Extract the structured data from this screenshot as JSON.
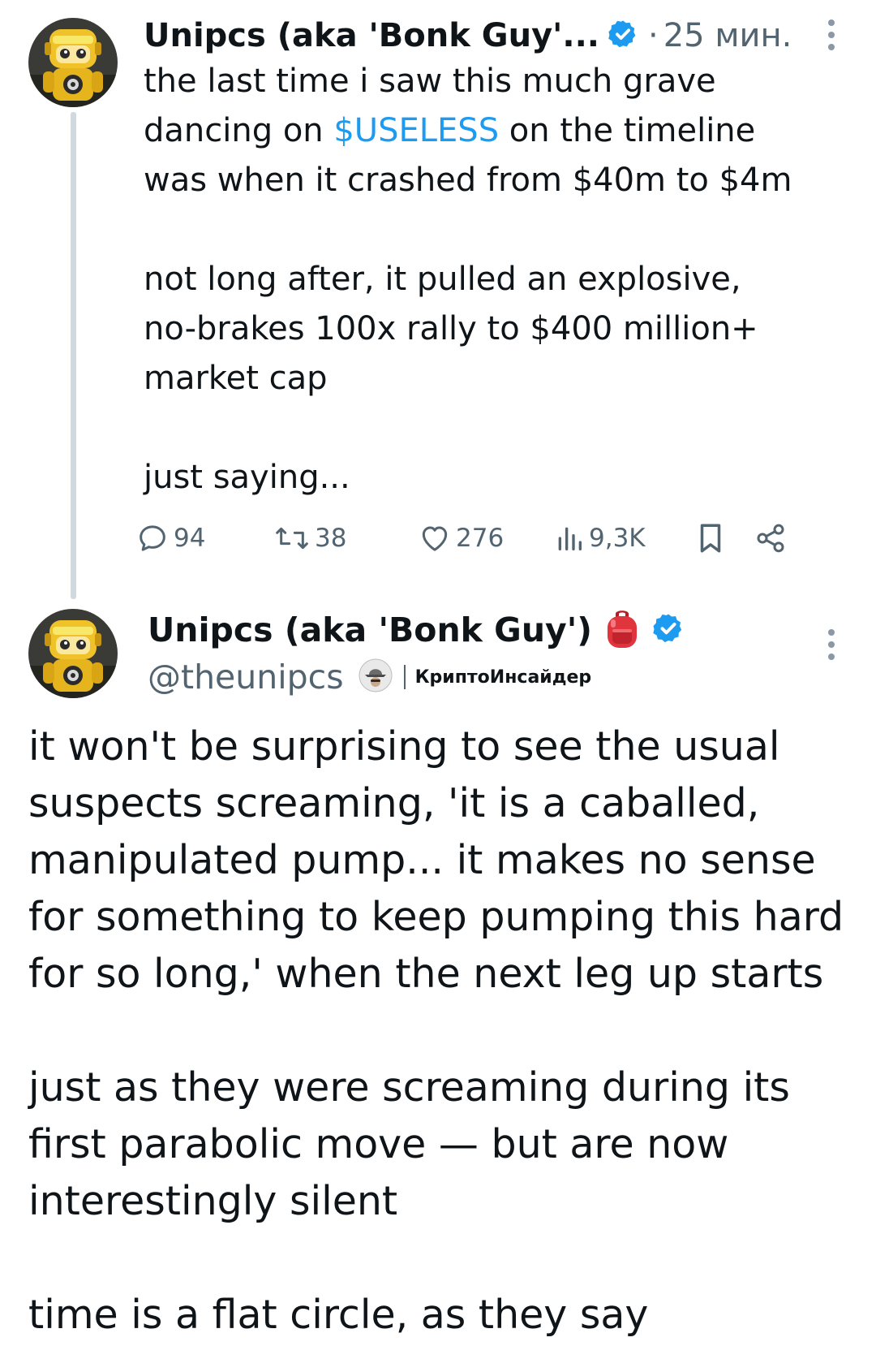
{
  "thread_parent": {
    "display_name": "Unipcs (aka 'Bonk Guy'...",
    "verified": true,
    "separator": "·",
    "time": "25 мин.",
    "avatar_icon": "robot-avatar-icon",
    "body_before_cashtag": "the last time i saw this much grave\ndancing on ",
    "cashtag": "$USELESS",
    "body_after_cashtag": " on the timeline\nwas when it crashed from $40m to $4m\n\nnot long after, it pulled an explosive,\nno-brakes 100x rally to $400 million+\nmarket cap\n\njust saying...",
    "actions": {
      "replies": "94",
      "reposts": "38",
      "likes": "276",
      "views": "9,3K"
    },
    "colors": {
      "cashtag": "#1d9bf0",
      "verified": "#1d9bf0",
      "meta": "#536471"
    }
  },
  "main_tweet": {
    "display_name": "Unipcs (aka 'Bonk Guy')",
    "name_emoji": "backpack-icon",
    "verified": true,
    "handle": "@theunipcs",
    "affiliation_icon": "hat-badge-icon",
    "affiliation_label": "КриптоИнсайдер",
    "body": "it won't be surprising to see the usual\nsuspects screaming, 'it is a caballed,\nmanipulated pump... it makes no sense\nfor something to keep pumping this hard\nfor so long,' when the next leg up starts\n\njust as they were screaming during its\nfirst parabolic move — but are now\ninterestingly silent\n\ntime is a flat circle, as they say"
  }
}
